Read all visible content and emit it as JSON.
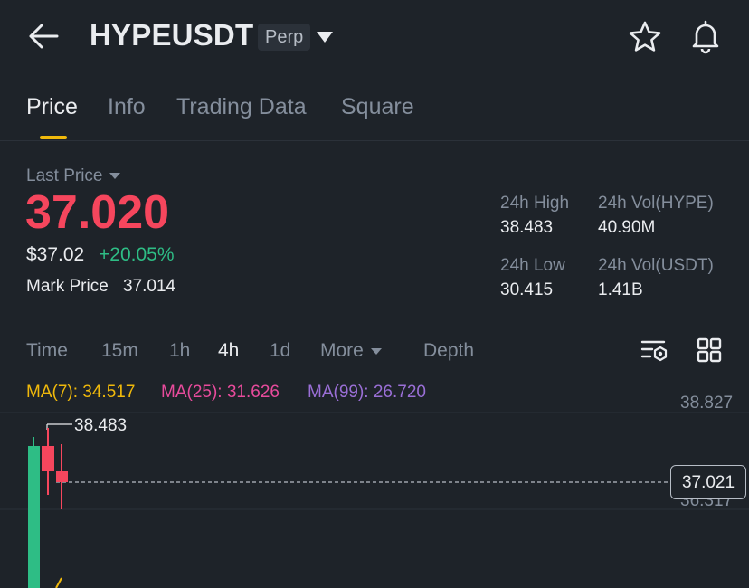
{
  "header": {
    "pair": "HYPEUSDT",
    "badge": "Perp"
  },
  "tabs": [
    "Price",
    "Info",
    "Trading Data",
    "Square"
  ],
  "price": {
    "last_price_label": "Last Price",
    "last_price": "37.020",
    "usd_price": "$37.02",
    "change_pct": "+20.05%",
    "mark_price_label": "Mark Price",
    "mark_price": "37.014"
  },
  "stats": {
    "high_label": "24h High",
    "high_value": "38.483",
    "vol_hype_label": "24h Vol(HYPE)",
    "vol_hype_value": "40.90M",
    "low_label": "24h Low",
    "low_value": "30.415",
    "vol_usdt_label": "24h Vol(USDT)",
    "vol_usdt_value": "1.41B"
  },
  "intervals": {
    "time": "Time",
    "m15": "15m",
    "h1": "1h",
    "h4": "4h",
    "d1": "1d",
    "more": "More",
    "depth": "Depth"
  },
  "ma": {
    "ma7": "MA(7): 34.517",
    "ma25": "MA(25): 31.626",
    "ma99": "MA(99): 26.720"
  },
  "chart": {
    "axis_top": "38.827",
    "axis_mid": "36.317",
    "high_marker": "38.483",
    "current_price_tag": "37.021"
  },
  "colors": {
    "up": "#2ebd85",
    "down": "#f6465d",
    "accent": "#f0b90b",
    "ma7": "#f0b90b",
    "ma25": "#e84b9c",
    "ma99": "#9a6fd6"
  }
}
